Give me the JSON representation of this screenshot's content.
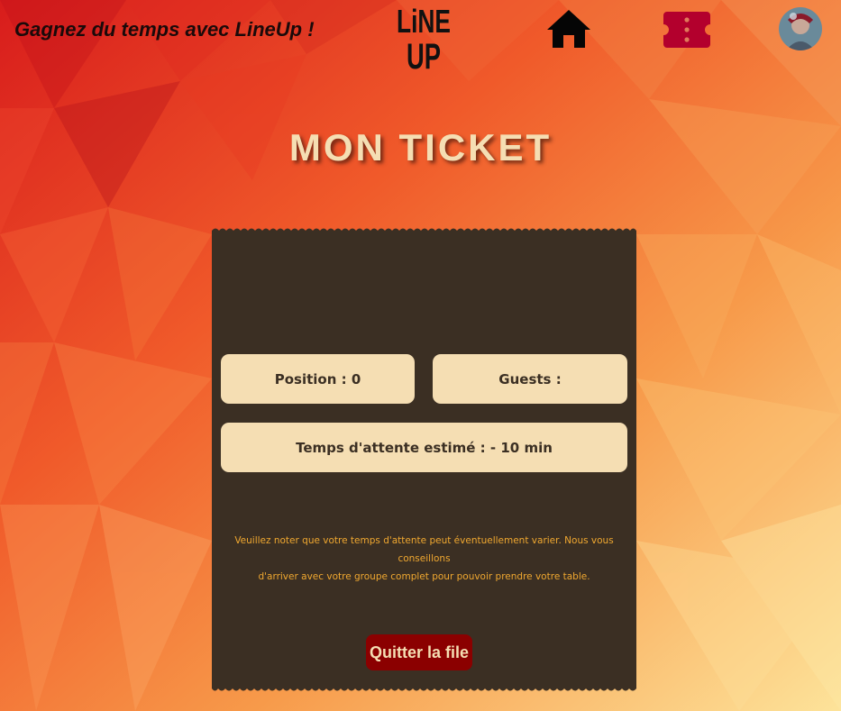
{
  "header": {
    "tagline": "Gagnez du temps avec LineUp !",
    "logo_top": "LiNE",
    "logo_bottom": "UP",
    "home_icon": "home-icon",
    "ticket_icon": "ticket-icon",
    "avatar": "avatar"
  },
  "page": {
    "title": "MON TICKET"
  },
  "ticket": {
    "position_label": "Position : 0",
    "guests_label": "Guests :",
    "wait_label": "Temps d'attente estimé : - 10 min",
    "notice_line1": "Veuillez noter que votre temps d'attente peut éventuellement varier. Nous vous conseillons",
    "notice_line2": "d'arriver avec votre groupe complet pour pouvoir prendre votre table.",
    "quit_button": "Quitter la file"
  },
  "colors": {
    "ticket_bg": "#3b2f23",
    "box_bg": "#f5deb3",
    "accent_red": "#8b0000",
    "icon_red": "#b3002d",
    "notice_text": "#f0a830",
    "title_text": "#f5deb3"
  }
}
